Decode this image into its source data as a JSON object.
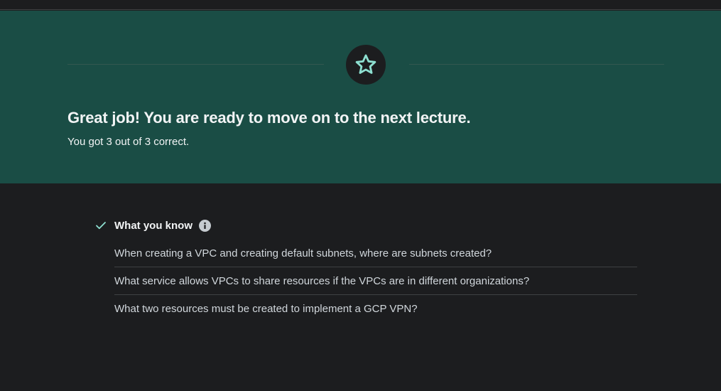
{
  "banner": {
    "headline": "Great job! You are ready to move on to the next lecture.",
    "score": "You got 3 out of 3 correct.",
    "badge_icon": "star-icon"
  },
  "what_you_know": {
    "title": "What you know",
    "status_icon": "check-icon",
    "info_icon": "info-icon",
    "questions": [
      "When creating a VPC and creating default subnets, where are subnets created?",
      "What service allows VPCs to share resources if the VPCs are in different organizations?",
      "What two resources must be created to implement a GCP VPN?"
    ]
  },
  "colors": {
    "banner_bg": "#1a4d45",
    "page_bg": "#1c1d1f",
    "accent": "#8ee0d1",
    "text": "#d1d7dc"
  }
}
